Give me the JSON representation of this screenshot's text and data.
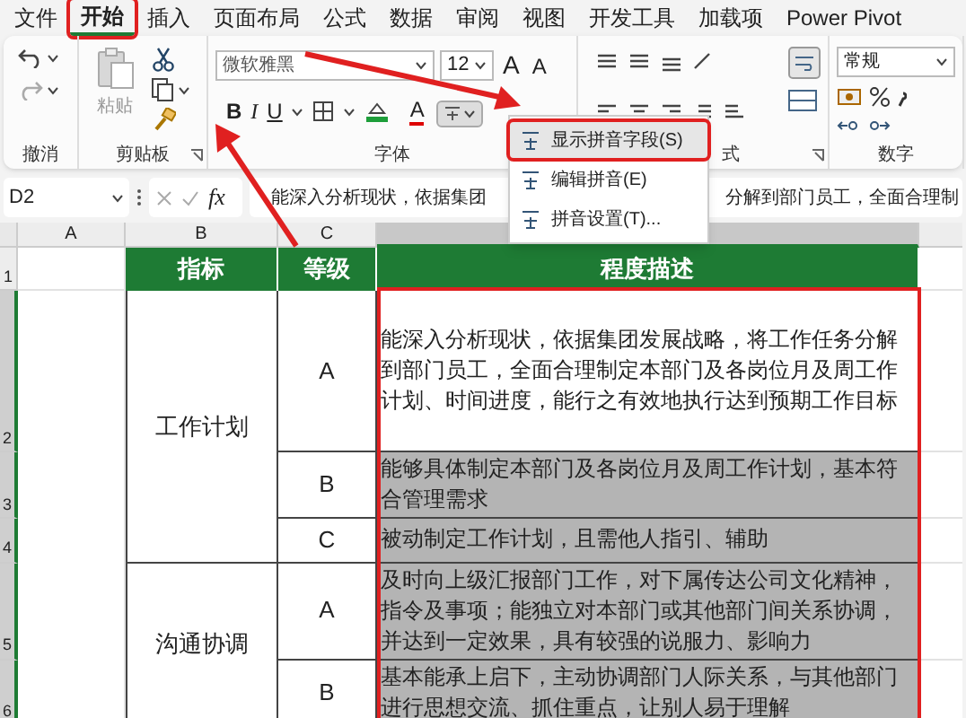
{
  "menu_tabs": [
    {
      "label": "文件",
      "selected": false
    },
    {
      "label": "开始",
      "selected": true
    },
    {
      "label": "插入",
      "selected": false
    },
    {
      "label": "页面布局",
      "selected": false
    },
    {
      "label": "公式",
      "selected": false
    },
    {
      "label": "数据",
      "selected": false
    },
    {
      "label": "审阅",
      "selected": false
    },
    {
      "label": "视图",
      "selected": false
    },
    {
      "label": "开发工具",
      "selected": false
    },
    {
      "label": "加载项",
      "selected": false
    },
    {
      "label": "Power Pivot",
      "selected": false
    }
  ],
  "ribbon": {
    "undo_label": "撤消",
    "paste_label": "粘贴",
    "clipboard_label": "剪贴板",
    "font_name": "微软雅黑",
    "font_size": "12",
    "grow_font": "A",
    "shrink_font": "A",
    "bold": "B",
    "italic": "I",
    "underline": "U",
    "font_color": "A",
    "font_label": "字体",
    "alignment_label": "式",
    "number_format": "常规",
    "number_label": "数字"
  },
  "pinyin_menu": [
    {
      "label": "显示拼音字段(S)",
      "selected": true
    },
    {
      "label": "编辑拼音(E)",
      "selected": false
    },
    {
      "label": "拼音设置(T)...",
      "selected": false
    }
  ],
  "formula_bar": {
    "name_box": "D2",
    "function_symbol": "fx",
    "formula_start": "能深入分析现状，依据集团",
    "formula_end": "分解到部门员工，全面合理制"
  },
  "column_headers": [
    {
      "label": "A",
      "selected": false
    },
    {
      "label": "B",
      "selected": false
    },
    {
      "label": "C",
      "selected": false
    },
    {
      "selected": true
    }
  ],
  "row_numbers": [
    {
      "label": "1",
      "selected": false
    },
    {
      "label": "2",
      "selected": true
    },
    {
      "label": "3",
      "selected": true
    },
    {
      "label": "4",
      "selected": true
    },
    {
      "label": "5",
      "selected": true
    },
    {
      "label": "6",
      "selected": true
    }
  ],
  "table": {
    "columns": [
      "指标",
      "等级",
      "程度描述"
    ],
    "groups": [
      {
        "indicator": "工作计划",
        "levels": [
          {
            "grade": "A",
            "description": "能深入分析现状，依据集团发展战略，将工作任务分解到部门员工，全面合理制定本部门及各岗位月及周工作计划、时间进度，能行之有效地执行达到预期工作目标",
            "selected": false
          },
          {
            "grade": "B",
            "description": "能够具体制定本部门及各岗位月及周工作计划，基本符合管理需求",
            "selected": true
          },
          {
            "grade": "C",
            "description": "被动制定工作计划，且需他人指引、辅助",
            "selected": true
          }
        ]
      },
      {
        "indicator": "沟通协调",
        "levels": [
          {
            "grade": "A",
            "description": "及时向上级汇报部门工作，对下属传达公司文化精神，指令及事项；能独立对本部门或其他部门间关系协调，并达到一定效果，具有较强的说服力、影响力",
            "selected": true
          },
          {
            "grade": "B",
            "description": "基本能承上启下，主动协调部门人际关系，与其他部门进行思想交流、抓住重点，让别人易于理解",
            "selected": true
          }
        ]
      }
    ]
  }
}
